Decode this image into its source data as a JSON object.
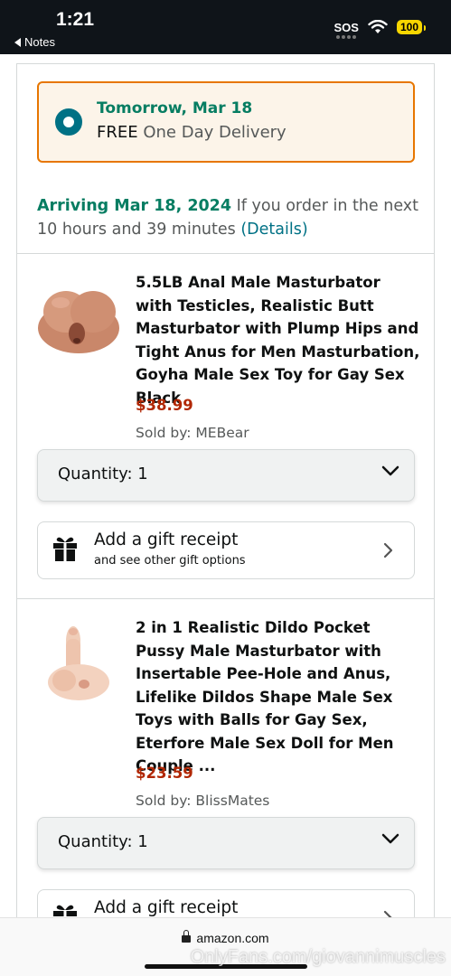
{
  "status_bar": {
    "time": "1:21",
    "back_label": "Notes",
    "sos": "SOS",
    "battery": "100"
  },
  "delivery": {
    "date": "Tomorrow, Mar 18",
    "free": "FREE",
    "option": "One Day Delivery",
    "arriving_date": "Arriving Mar 18, 2024",
    "arriving_text": "If you order in the next 10 hours and 39 minutes",
    "details_link": "(Details)"
  },
  "items": [
    {
      "title": "5.5LB Anal Male Masturbator with Testicles, Realistic Butt Masturbator with Plump Hips and Tight Anus for Men Masturbation, Goyha Male Sex Toy for Gay Sex Black",
      "price": "$38.99",
      "seller": "Sold by: MEBear",
      "quantity_label": "Quantity:",
      "quantity": "1",
      "gift_title": "Add a gift receipt",
      "gift_sub": "and see other gift options"
    },
    {
      "title": "2 in 1 Realistic Dildo Pocket Pussy Male Masturbator with Insertable Pee-Hole and Anus, Lifelike Dildos Shape Male Sex Toys with Balls for Gay Sex, Eterfore Male Sex Doll for Men Couple ...",
      "price": "$23.59",
      "seller": "Sold by: BlissMates",
      "quantity_label": "Quantity:",
      "quantity": "1",
      "gift_title": "Add a gift receipt"
    }
  ],
  "browser": {
    "url": "amazon.com",
    "watermark": "OnlyFans.com/giovannimuscles"
  },
  "colors": {
    "accent_teal": "#007185",
    "green": "#067d62",
    "price_red": "#b12704",
    "delivery_border": "#e77600"
  }
}
